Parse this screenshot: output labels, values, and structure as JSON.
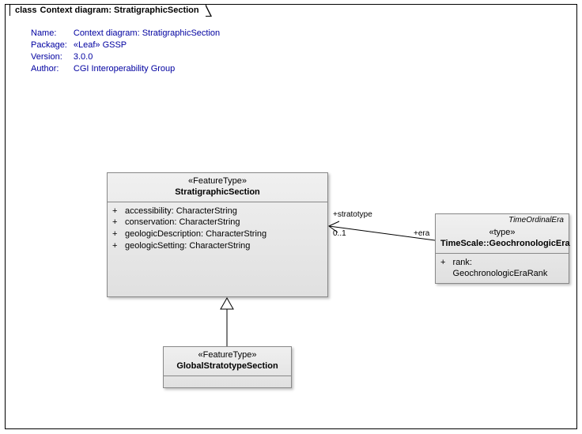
{
  "frame": {
    "prefix": "class",
    "title": "Context diagram: StratigraphicSection"
  },
  "meta": {
    "nameLabel": "Name:",
    "nameValue": "Context diagram: StratigraphicSection",
    "packageLabel": "Package:",
    "packageValue": "«Leaf» GSSP",
    "versionLabel": "Version:",
    "versionValue": "3.0.0",
    "authorLabel": "Author:",
    "authorValue": "CGI Interoperability Group"
  },
  "classes": {
    "stratSection": {
      "stereotype": "«FeatureType»",
      "name": "StratigraphicSection",
      "attrs": [
        {
          "vis": "+",
          "text": "accessibility: CharacterString"
        },
        {
          "vis": "+",
          "text": "conservation: CharacterString"
        },
        {
          "vis": "+",
          "text": "geologicDescription: CharacterString"
        },
        {
          "vis": "+",
          "text": "geologicSetting: CharacterString"
        }
      ]
    },
    "globalStrato": {
      "stereotype": "«FeatureType»",
      "name": "GlobalStratotypeSection"
    },
    "geochronEra": {
      "parent": "TimeOrdinalEra",
      "stereotype": "«type»",
      "name": "TimeScale::GeochronologicEra",
      "attrs": [
        {
          "vis": "+",
          "text": "rank: GeochronologicEraRank"
        }
      ]
    }
  },
  "assoc": {
    "stratotypeRole": "+stratotype",
    "stratotypeMult": "0..1",
    "eraRole": "+era"
  },
  "chart_data": {
    "type": "uml_class_diagram",
    "title": "Context diagram: StratigraphicSection",
    "classes": [
      {
        "id": "StratigraphicSection",
        "stereotype": "FeatureType",
        "attributes": [
          "+ accessibility: CharacterString",
          "+ conservation: CharacterString",
          "+ geologicDescription: CharacterString",
          "+ geologicSetting: CharacterString"
        ]
      },
      {
        "id": "GlobalStratotypeSection",
        "stereotype": "FeatureType",
        "attributes": []
      },
      {
        "id": "TimeScale::GeochronologicEra",
        "stereotype": "type",
        "parent": "TimeOrdinalEra",
        "attributes": [
          "+ rank: GeochronologicEraRank"
        ]
      }
    ],
    "relationships": [
      {
        "type": "generalization",
        "child": "GlobalStratotypeSection",
        "parent": "StratigraphicSection"
      },
      {
        "type": "association",
        "ends": [
          {
            "class": "StratigraphicSection",
            "role": "+stratotype",
            "multiplicity": "0..1",
            "navigable": true
          },
          {
            "class": "TimeScale::GeochronologicEra",
            "role": "+era"
          }
        ]
      }
    ]
  }
}
